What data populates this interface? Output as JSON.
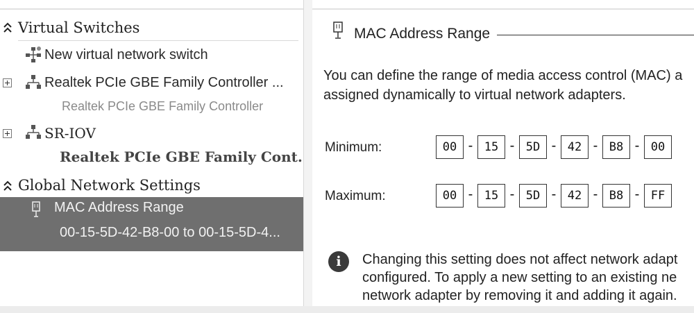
{
  "tree": {
    "virtual_switches_header": "Virtual Switches",
    "new_switch": "New virtual network switch",
    "switch1": {
      "name": "Realtek PCIe GBE Family Controller ...",
      "subtitle": "Realtek PCIe GBE Family Controller"
    },
    "switch2": {
      "name": "SR-IOV",
      "subtitle": "Realtek PCIe GBE Family Cont..."
    },
    "global_header": "Global Network Settings",
    "mac_item": {
      "name": "MAC Address Range",
      "subtitle": "00-15-5D-42-B8-00 to 00-15-5D-4..."
    }
  },
  "details": {
    "title": "MAC Address Range",
    "description_line1": "You can define the range of media access control (MAC) a",
    "description_line2": "assigned dynamically to virtual network adapters.",
    "minimum_label": "Minimum:",
    "maximum_label": "Maximum:",
    "minimum": [
      "00",
      "15",
      "5D",
      "42",
      "B8",
      "00"
    ],
    "maximum": [
      "00",
      "15",
      "5D",
      "42",
      "B8",
      "FF"
    ],
    "separator": "-",
    "note_line1": "Changing this setting does not affect network adapt",
    "note_line2": "configured.  To apply a new setting to an existing ne",
    "note_line3": "network adapter by removing it and adding it again."
  },
  "colors": {
    "selection": "#6f6f6f",
    "selection_text": "#f2f2f2"
  },
  "icons": [
    "collapse-icon",
    "network-switch-icon",
    "expand-icon",
    "mac-address-icon",
    "info-icon"
  ]
}
